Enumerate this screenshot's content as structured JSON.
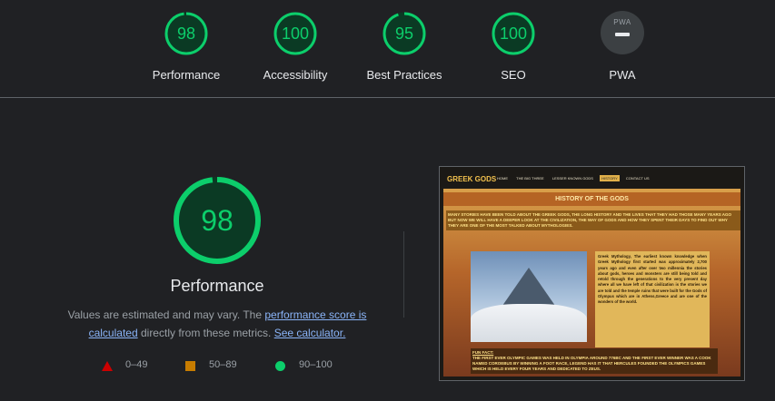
{
  "summary": {
    "gauges": [
      {
        "score": "98",
        "label": "Performance"
      },
      {
        "score": "100",
        "label": "Accessibility"
      },
      {
        "score": "95",
        "label": "Best Practices"
      },
      {
        "score": "100",
        "label": "SEO"
      }
    ],
    "pwa": {
      "badge_text": "PWA",
      "label": "PWA"
    }
  },
  "main": {
    "score": "98",
    "title": "Performance",
    "desc_prefix": "Values are estimated and may vary. The ",
    "link_score": "performance score is calculated",
    "desc_middle": " directly from these metrics. ",
    "link_calc": "See calculator."
  },
  "legend": [
    {
      "range": "0–49",
      "color": "#cc0000"
    },
    {
      "range": "50–89",
      "color": "#c77c00"
    },
    {
      "range": "90–100",
      "color": "#0cce6b"
    }
  ],
  "colors": {
    "pass": "#0cce6b",
    "background": "#202124",
    "link": "#8ab4f8"
  },
  "screenshot": {
    "logo": "GREEK GODS",
    "nav": [
      "HOME",
      "THE BIG THREE",
      "LESSER KNOWN GODS",
      "HISTORY",
      "CONTACT US"
    ],
    "active_nav": "HISTORY",
    "banner": "HISTORY OF THE GODS",
    "intro": "MANY STORIES HAVE BEEN TOLD ABOUT THE GREEK GODS, THE LONG HISTORY AND THE LIVES THAT THEY HAD THOSE MANY YEARS AGO BUT NOW WE WILL HAVE A DEEPER LOOK AT THE CIVILIZATION, THE WAY OF GODS AND HOW THEY SPENT THEIR DAYS TO FIND OUT WHY THEY ARE ONE OF THE MOST TALKED ABOUT MYTHOLOGIES.",
    "myth_text": "Greek Mythology, The earliest known knowledge when Greek Mythology first started was approximately 2,700 years ago and even after over two millennia the stories about gods, heroes and monsters are still being told and retold through the generations to the very present day where all we have left of that civilization is the stories we are told and the temple ruins that were built for the Gods of Olympus which are in Athens,Greece and are one of the wonders of the world.",
    "funfact_title": "FUN FACT:",
    "funfact": "THE FIRST EVER OLYMPIC GAMES WAS HELD IN OLYMPIA AROUND 776BC AND THE FIRST EVER WINNER WAS A COOK NAMED COROEBUS BY WINNING A FOOT RACE, LEGEND HAS IT THAT HERCULES FOUNDED THE OLYMPICS GAMES WHICH IS HELD EVERY FOUR YEARS AND DEDICATED TO ZEUS."
  }
}
